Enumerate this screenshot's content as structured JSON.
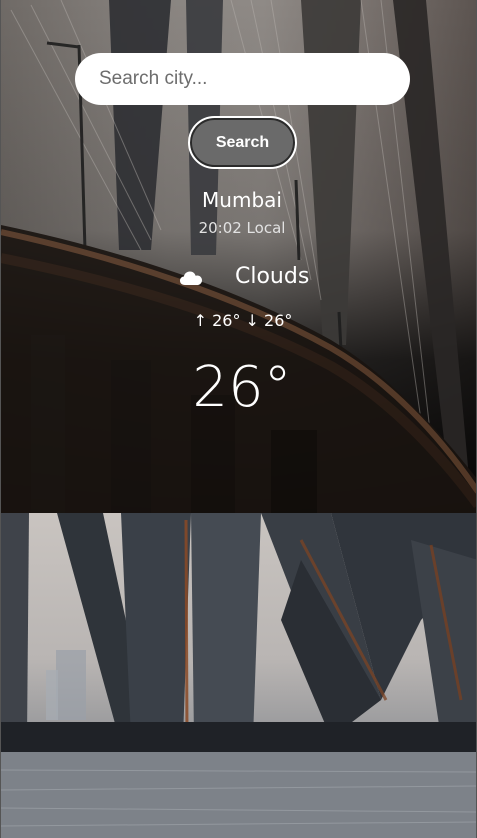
{
  "search": {
    "placeholder": "Search city...",
    "value": "",
    "button_label": "Search"
  },
  "weather": {
    "city": "Mumbai",
    "local_time": "20:02 Local",
    "condition": "Clouds",
    "condition_icon": "cloud-icon",
    "temp_max": "26°",
    "temp_min": "26°",
    "minmax_text": "↑ 26° ↓ 26°",
    "temperature": "26°"
  },
  "colors": {
    "text": "#ffffff",
    "button_bg": "#6a6a6a",
    "input_bg": "#ffffff"
  }
}
